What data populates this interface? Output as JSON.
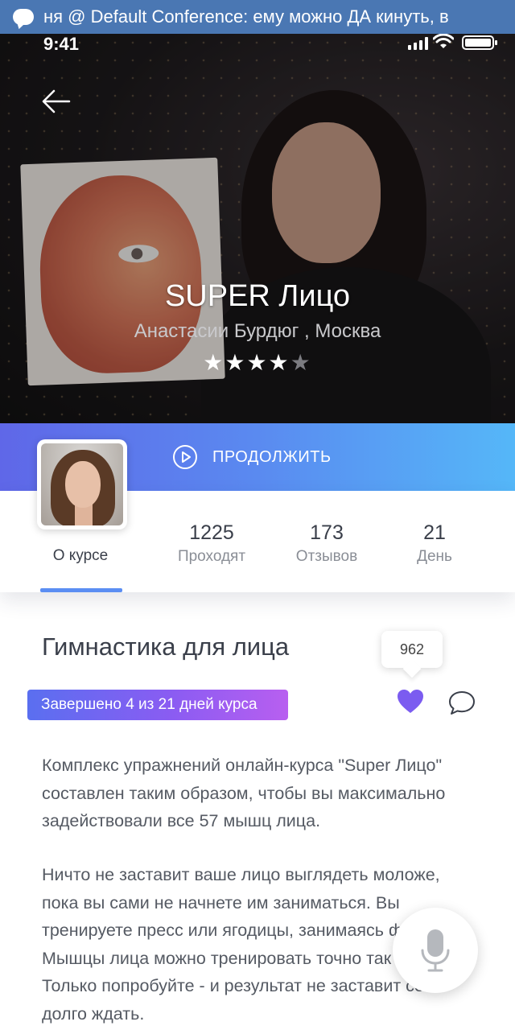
{
  "notification": {
    "text": "ня @ Default Conference: ему можно ДА кинуть, в"
  },
  "status_bar": {
    "time": "9:41"
  },
  "hero": {
    "title": "SUPER Лицо",
    "author": "Анастасии Бурдюг , Москва",
    "rating": 4,
    "rating_max": 5,
    "stars": [
      "★",
      "★",
      "★",
      "★",
      "★"
    ]
  },
  "continue": {
    "label": "ПРОДОЛЖИТЬ"
  },
  "tabs": {
    "course_label": "О курсе"
  },
  "stats": [
    {
      "value": "1225",
      "label": "Проходят"
    },
    {
      "value": "173",
      "label": "Отзывов"
    },
    {
      "value": "21",
      "label": "День"
    }
  ],
  "course": {
    "title": "Гимнастика для лица",
    "progress_text": "Завершено 4 из 21 дней курса",
    "likes": "962",
    "paragraph1": "Комплекс упражнений онлайн-курса \"Super Лицо\" составлен таким образом, чтобы вы максимально задействовали все 57 мышц лица.",
    "paragraph2": "Ничто не заставит ваше лицо выглядеть моложе, пока вы сами не начнете им заниматься. Вы тренируете пресс или ягодицы, занимаясь фитнесом. Мышцы лица можно тренировать точно так же. Только попробуйте - и результат не заставит себя долго ждать."
  },
  "colors": {
    "accent_gradient_start": "#5f67e8",
    "accent_gradient_end": "#55b7f8",
    "badge_gradient_start": "#5a6ff0",
    "badge_gradient_end": "#b85ff0",
    "heart": "#7b5cf0",
    "tab_underline": "#5b8ef3",
    "notification_bg": "#4a77b3"
  },
  "icons": {
    "back": "arrow-left-icon",
    "play": "play-circle-icon",
    "like": "heart-icon",
    "comment": "comment-bubble-icon",
    "mic": "microphone-icon",
    "notification": "message-bubble-icon"
  }
}
